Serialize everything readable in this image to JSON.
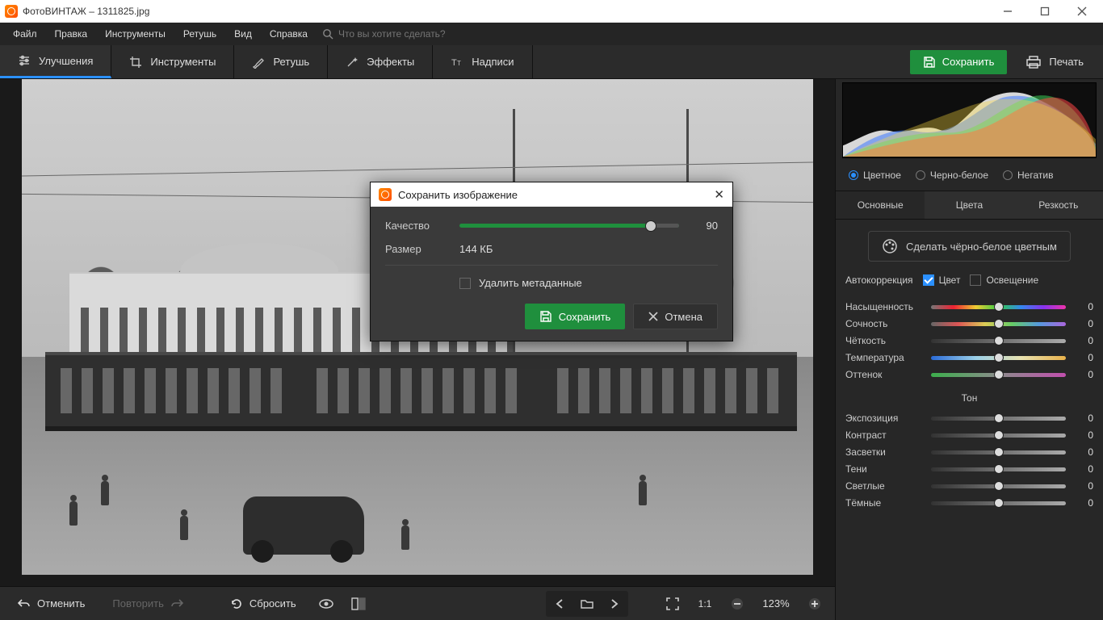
{
  "titlebar": {
    "title": "ФотоВИНТАЖ – 1311825.jpg"
  },
  "menu": {
    "items": [
      "Файл",
      "Правка",
      "Инструменты",
      "Ретушь",
      "Вид",
      "Справка"
    ],
    "search_placeholder": "Что вы хотите сделать?"
  },
  "tooltabs": {
    "items": [
      "Улучшения",
      "Инструменты",
      "Ретушь",
      "Эффекты",
      "Надписи"
    ],
    "active": 0,
    "save": "Сохранить",
    "print": "Печать"
  },
  "bottombar": {
    "undo": "Отменить",
    "redo": "Повторить",
    "reset": "Сбросить",
    "zoom_ratio": "1:1",
    "zoom_pct": "123%"
  },
  "rightpanel": {
    "colormodes": [
      "Цветное",
      "Черно-белое",
      "Негатив"
    ],
    "colormode_active": 0,
    "subtabs": [
      "Основные",
      "Цвета",
      "Резкость"
    ],
    "subtab_active": 0,
    "bw_button": "Сделать чёрно-белое цветным",
    "autocorr_label": "Автокоррекция",
    "auto_color": "Цвет",
    "auto_light": "Освещение",
    "section_tone": "Тон",
    "sliders": [
      {
        "label": "Насыщенность",
        "value": "0",
        "track": "sat",
        "pos": 50
      },
      {
        "label": "Сочность",
        "value": "0",
        "track": "vib",
        "pos": 50
      },
      {
        "label": "Чёткость",
        "value": "0",
        "track": "gray",
        "pos": 50
      },
      {
        "label": "Температура",
        "value": "0",
        "track": "temp",
        "pos": 50
      },
      {
        "label": "Оттенок",
        "value": "0",
        "track": "tint",
        "pos": 50
      }
    ],
    "tone_sliders": [
      {
        "label": "Экспозиция",
        "value": "0",
        "track": "gray",
        "pos": 50
      },
      {
        "label": "Контраст",
        "value": "0",
        "track": "gray",
        "pos": 50
      },
      {
        "label": "Засветки",
        "value": "0",
        "track": "gray",
        "pos": 50
      },
      {
        "label": "Тени",
        "value": "0",
        "track": "gray",
        "pos": 50
      },
      {
        "label": "Светлые",
        "value": "0",
        "track": "gray",
        "pos": 50
      },
      {
        "label": "Тёмные",
        "value": "0",
        "track": "gray",
        "pos": 50
      }
    ]
  },
  "modal": {
    "title": "Сохранить изображение",
    "quality_label": "Качество",
    "quality_value": "90",
    "size_label": "Размер",
    "size_value": "144 КБ",
    "delete_meta": "Удалить метаданные",
    "save": "Сохранить",
    "cancel": "Отмена"
  }
}
